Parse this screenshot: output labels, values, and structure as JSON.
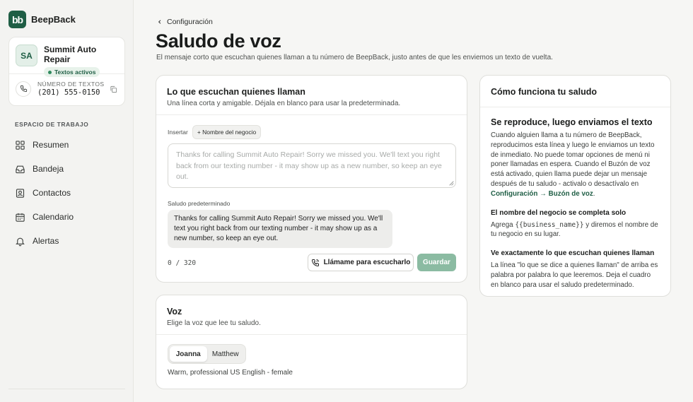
{
  "brand": {
    "logo": "bb",
    "name": "BeepBack"
  },
  "business": {
    "initials": "SA",
    "name": "Summit Auto Repair",
    "status": "Textos activos",
    "phone_label": "NÚMERO DE TEXTOS",
    "phone": "(201) 555-0150"
  },
  "sidebar": {
    "section_label": "ESPACIO DE TRABAJO",
    "items": [
      {
        "label": "Resumen",
        "icon": "grid-icon"
      },
      {
        "label": "Bandeja",
        "icon": "inbox-icon"
      },
      {
        "label": "Contactos",
        "icon": "contact-card-icon"
      },
      {
        "label": "Calendario",
        "icon": "calendar-icon"
      },
      {
        "label": "Alertas",
        "icon": "bell-icon"
      }
    ]
  },
  "page": {
    "back_label": "Configuración",
    "title": "Saludo de voz",
    "subtitle": "El mensaje corto que escuchan quienes llaman a tu número de BeepBack, justo antes de que les enviemos un texto de vuelta."
  },
  "greeting_card": {
    "title": "Lo que escuchan quienes llaman",
    "desc": "Una línea corta y amigable. Déjala en blanco para usar la predeterminada.",
    "insert_label": "Insertar",
    "insert_chip": "+ Nombre del negocio",
    "placeholder": "Thanks for calling Summit Auto Repair! Sorry we missed you. We'll text you right back from our texting number - it may show up as a new number, so keep an eye out.",
    "default_label": "Saludo predeterminado",
    "default_text": "Thanks for calling Summit Auto Repair! Sorry we missed you. We'll text you right back from our texting number - it may show up as a new number, so keep an eye out.",
    "counter": "0 / 320",
    "listen_button": "Llámame para escucharlo",
    "save_button": "Guardar"
  },
  "voice_card": {
    "title": "Voz",
    "desc": "Elige la voz que lee tu saludo.",
    "options": [
      "Joanna",
      "Matthew"
    ],
    "selected": "Joanna",
    "voice_desc": "Warm, professional US English - female"
  },
  "how_card": {
    "title": "Cómo funciona tu saludo",
    "h1": "Se reproduce, luego enviamos el texto",
    "p1": "Cuando alguien llama a tu número de BeepBack, reproducimos esta línea y luego le enviamos un texto de inmediato. No puede tomar opciones de menú ni poner llamadas en espera. Cuando el Buzón de voz está activado, quien llama puede dejar un mensaje después de tu saludo - activalo o desactívalo en",
    "p1_link": "Configuración → Buzón de voz",
    "p1_end": ".",
    "h2": "El nombre del negocio se completa solo",
    "p2_pre": "Agrega",
    "p2_code": "{{business_name}}",
    "p2_post": "y diremos el nombre de tu negocio en su lugar.",
    "h3": "Ve exactamente lo que escuchan quienes llaman",
    "p3": "La línea \"lo que se dice a quienes llaman\" de arriba es palabra por palabra lo que leeremos. Deja el cuadro en blanco para usar el saludo predeterminado."
  },
  "colors": {
    "brand": "#1f5e45",
    "save_disabled": "#8bbba2"
  }
}
